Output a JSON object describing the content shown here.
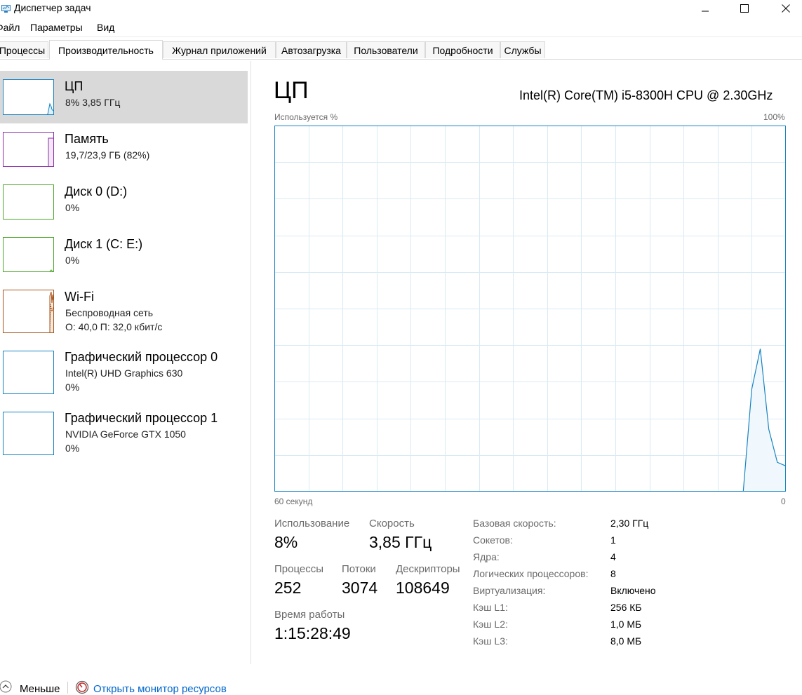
{
  "window": {
    "title": "Диспетчер задач"
  },
  "menu": {
    "items": [
      "Файл",
      "Параметры",
      "Вид"
    ]
  },
  "tabs": [
    {
      "label": "Процессы",
      "active": false
    },
    {
      "label": "Производительность",
      "active": true
    },
    {
      "label": "Журнал приложений",
      "active": false
    },
    {
      "label": "Автозагрузка",
      "active": false
    },
    {
      "label": "Пользователи",
      "active": false
    },
    {
      "label": "Подробности",
      "active": false
    },
    {
      "label": "Службы",
      "active": false
    }
  ],
  "sidebar": {
    "items": [
      {
        "title": "ЦП",
        "line1": "8% 3,85 ГГц",
        "line2": "",
        "color": "#1783c2",
        "selected": true
      },
      {
        "title": "Память",
        "line1": "19,7/23,9 ГБ (82%)",
        "line2": "",
        "color": "#8b2fa8",
        "selected": false
      },
      {
        "title": "Диск 0 (D:)",
        "line1": "0%",
        "line2": "",
        "color": "#4da52b",
        "selected": false
      },
      {
        "title": "Диск 1 (C: E:)",
        "line1": "0%",
        "line2": "",
        "color": "#4da52b",
        "selected": false
      },
      {
        "title": "Wi-Fi",
        "line1": "Беспроводная сеть",
        "line2": "О: 40,0  П: 32,0 кбит/с",
        "color": "#a7541b",
        "selected": false
      },
      {
        "title": "Графический процессор 0",
        "line1": "Intel(R) UHD Graphics 630",
        "line2": "0%",
        "color": "#1783c2",
        "selected": false
      },
      {
        "title": "Графический процессор 1",
        "line1": "NVIDIA GeForce GTX 1050",
        "line2": "0%",
        "color": "#1783c2",
        "selected": false
      }
    ]
  },
  "main": {
    "title": "ЦП",
    "cpu_model": "Intel(R) Core(TM) i5-8300H CPU @ 2.30GHz",
    "graph": {
      "top_left_label": "Используется %",
      "top_right_label": "100%",
      "bottom_left_label": "60 секунд",
      "bottom_right_label": "0",
      "line_color": "#1783c2",
      "grid_color": "#d9eaf4",
      "border_color": "#1783c2"
    },
    "stats": {
      "usage_label": "Использование",
      "usage_value": "8%",
      "speed_label": "Скорость",
      "speed_value": "3,85 ГГц",
      "processes_label": "Процессы",
      "processes_value": "252",
      "threads_label": "Потоки",
      "threads_value": "3074",
      "handles_label": "Дескрипторы",
      "handles_value": "108649",
      "uptime_label": "Время работы",
      "uptime_value": "1:15:28:49"
    },
    "specs": [
      {
        "label": "Базовая скорость:",
        "value": "2,30 ГГц"
      },
      {
        "label": "Сокетов:",
        "value": "1"
      },
      {
        "label": "Ядра:",
        "value": "4"
      },
      {
        "label": "Логических процессоров:",
        "value": "8"
      },
      {
        "label": "Виртуализация:",
        "value": "Включено"
      },
      {
        "label": "Кэш L1:",
        "value": "256 КБ"
      },
      {
        "label": "Кэш L2:",
        "value": "1,0 МБ"
      },
      {
        "label": "Кэш L3:",
        "value": "8,0 МБ"
      }
    ]
  },
  "footer": {
    "less_label": "Меньше",
    "monitor_link": "Открыть монитор ресурсов"
  },
  "chart_data": {
    "type": "area",
    "xlabel": "60 секунд",
    "ylabel": "Используется %",
    "xlim": [
      60,
      0
    ],
    "ylim": [
      0,
      100
    ],
    "x": [
      60,
      50,
      40,
      30,
      20,
      10,
      5,
      4,
      3,
      2,
      1,
      0
    ],
    "values": [
      0,
      0,
      0,
      0,
      0,
      0,
      0,
      28,
      39,
      17,
      8,
      7
    ]
  }
}
